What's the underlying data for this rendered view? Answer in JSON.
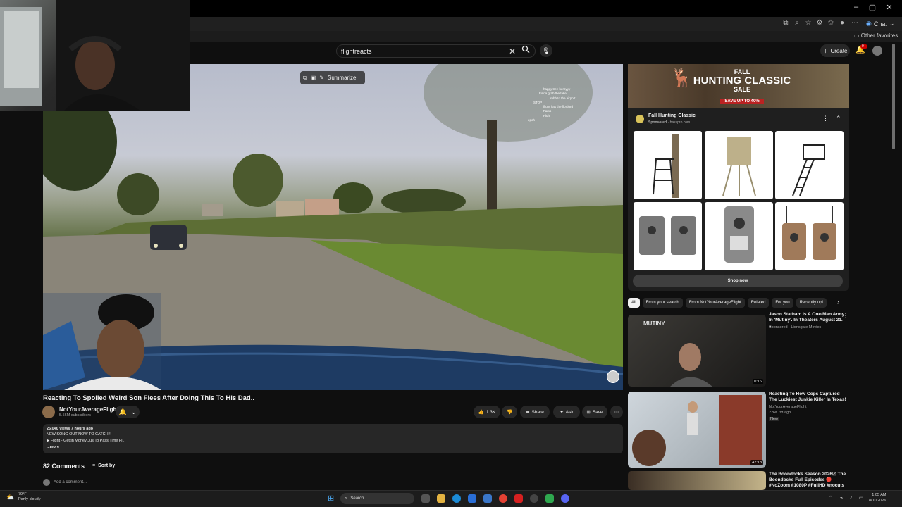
{
  "browser": {
    "window_controls": [
      "–",
      "▢",
      "✕"
    ],
    "chat_label": "Chat",
    "other_favorites": "Other favorites"
  },
  "header": {
    "search_value": "flightreacts",
    "create_label": "Create",
    "notification_count": "9+"
  },
  "player": {
    "summarize_label": "Summarize",
    "chat_lines": [
      "happy tree berbyyy",
      "Finna grab the fake",
      "ruhh to the airport",
      "STOP",
      "flight has the ffortlord",
      "Fams",
      "Pluh",
      "",
      "",
      "epoh",
      "",
      "",
      ""
    ]
  },
  "video": {
    "title": "Reacting To Spoiled Weird Son Flees After Doing This To His Dad..",
    "channel": "NotYourAverageFlight",
    "subscribers": "5.56M subscribers",
    "likes": "1.3K",
    "share_label": "Share",
    "ask_label": "Ask",
    "save_label": "Save",
    "desc_stats": "26,040 views  7 hours ago",
    "desc_line1": "NEW SONG OUT NOW TO CATCH!!",
    "desc_line2": "▶ Flight - Gettin Money Jus To Pass Time Fl...",
    "desc_more": "...more"
  },
  "comments": {
    "count_label": "82 Comments",
    "sort_label": "Sort by",
    "add_placeholder": "Add a comment..."
  },
  "ad": {
    "banner_line1": "FALL",
    "banner_line2": "HUNTING CLASSIC",
    "banner_line3": "SALE",
    "banner_offer": "SAVE UP TO 40%",
    "title": "Fall Hunting Classic",
    "sponsor": "Sponsored",
    "domain": "basspro.com",
    "shop_now": "Shop now"
  },
  "chips": [
    "All",
    "From your search",
    "From NotYourAverageFlight",
    "Related",
    "For you",
    "Recently upl"
  ],
  "related": [
    {
      "title": "Jason Statham Is A One-Man Army In 'Mutiny'. In Theaters August 21. ...",
      "sub1": "Sponsored · Lionsgate Movies",
      "duration": "0:16",
      "thumb_text": "MUTINY"
    },
    {
      "title": "Reacting To How Cops Captured The Luckiest Junkie Killer In Texas!",
      "sub1": "NotYourAverageFlight",
      "sub2": "226K  3d ago",
      "badge": "New",
      "duration": "42:18"
    },
    {
      "title": "The Boondocks Season 2026☑ The Boondocks Full Episodes 🔴 #NoZoom #1080P #FullHD #nocuts",
      "sub1": ""
    }
  ],
  "taskbar": {
    "temp": "79°F",
    "weather": "Partly cloudy",
    "search_label": "Search",
    "time": "1:05 AM",
    "date": "8/10/2026"
  },
  "colors": {
    "bg": "#0f0f0f",
    "pill": "#272727",
    "accent_red": "#cc0000"
  }
}
